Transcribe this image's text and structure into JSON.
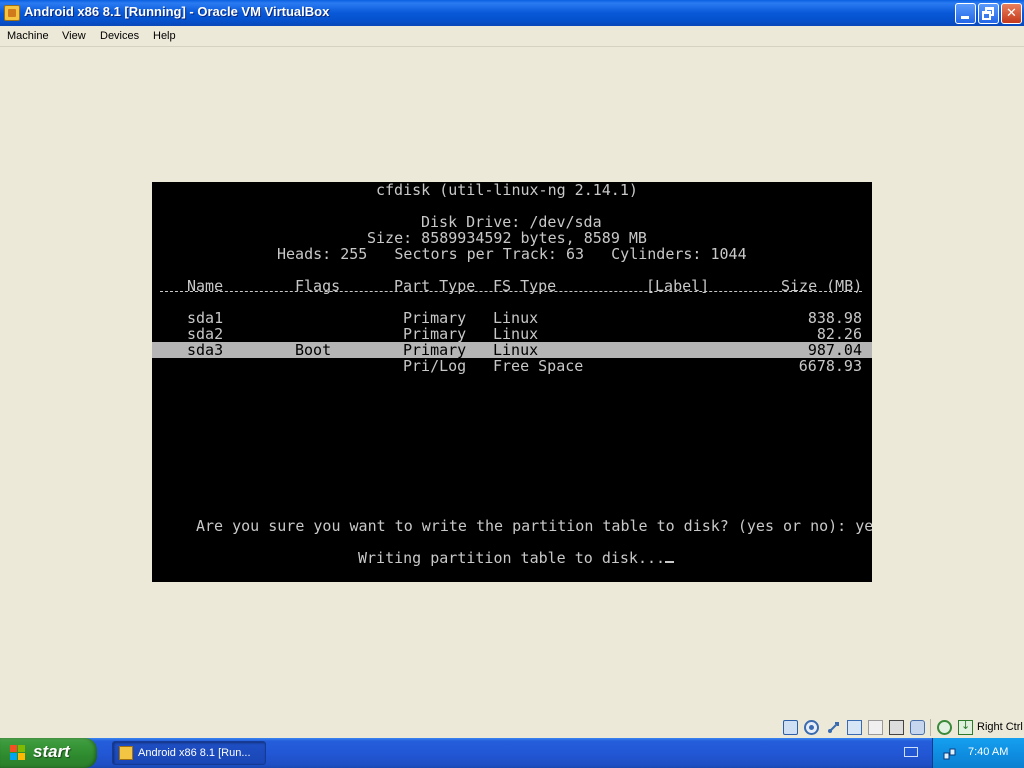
{
  "window": {
    "title": "Android x86 8.1 [Running] - Oracle VM VirtualBox",
    "minimize_glyph": "_",
    "maximize_glyph": "□",
    "close_glyph": "✕"
  },
  "menubar": {
    "items": [
      "Machine",
      "View",
      "Devices",
      "Help"
    ]
  },
  "terminal": {
    "program_title": "cfdisk (util-linux-ng 2.14.1)",
    "disk_drive": "Disk Drive: /dev/sda",
    "size_line": "Size: 8589934592 bytes, 8589 MB",
    "geometry_line": "Heads: 255   Sectors per Track: 63   Cylinders: 1044",
    "columns": {
      "name": "Name",
      "flags": "Flags",
      "part_type": "Part Type",
      "fs_type": "FS Type",
      "label": "[Label]",
      "size": "Size (MB)"
    },
    "rows": [
      {
        "name": "sda1",
        "flags": "",
        "part_type": "Primary",
        "fs_type": "Linux",
        "size": "838.98"
      },
      {
        "name": "sda2",
        "flags": "",
        "part_type": "Primary",
        "fs_type": "Linux",
        "size": "82.26"
      },
      {
        "name": "sda3",
        "flags": "Boot",
        "part_type": "Primary",
        "fs_type": "Linux",
        "size": "987.04"
      },
      {
        "name": "",
        "flags": "",
        "part_type": "Pri/Log",
        "fs_type": "Free Space",
        "size": "6678.93"
      }
    ],
    "selected_row": 2,
    "prompt": "Are you sure you want to write the partition table to disk? (yes or no): ye",
    "status": "Writing partition table to disk..."
  },
  "statusbar": {
    "icons": [
      "hard-disk-icon",
      "optical-drive-icon",
      "usb-icon",
      "network-icon",
      "shared-folder-icon",
      "video-capture-icon",
      "recording-icon",
      "mouse-integration-icon",
      "keyboard-capture-icon"
    ],
    "host_key": "Right Ctrl"
  },
  "taskbar": {
    "start_label": "start",
    "task_label": "Android x86 8.1 [Run...",
    "clock": "7:40 AM"
  },
  "colors": {
    "titlebar": "#0858d8",
    "terminal_bg": "#000000",
    "terminal_fg": "#c8c8c8",
    "highlight": "#b5b5b5",
    "start_green": "#3b9a3b",
    "tray_blue": "#0f8fe2"
  }
}
